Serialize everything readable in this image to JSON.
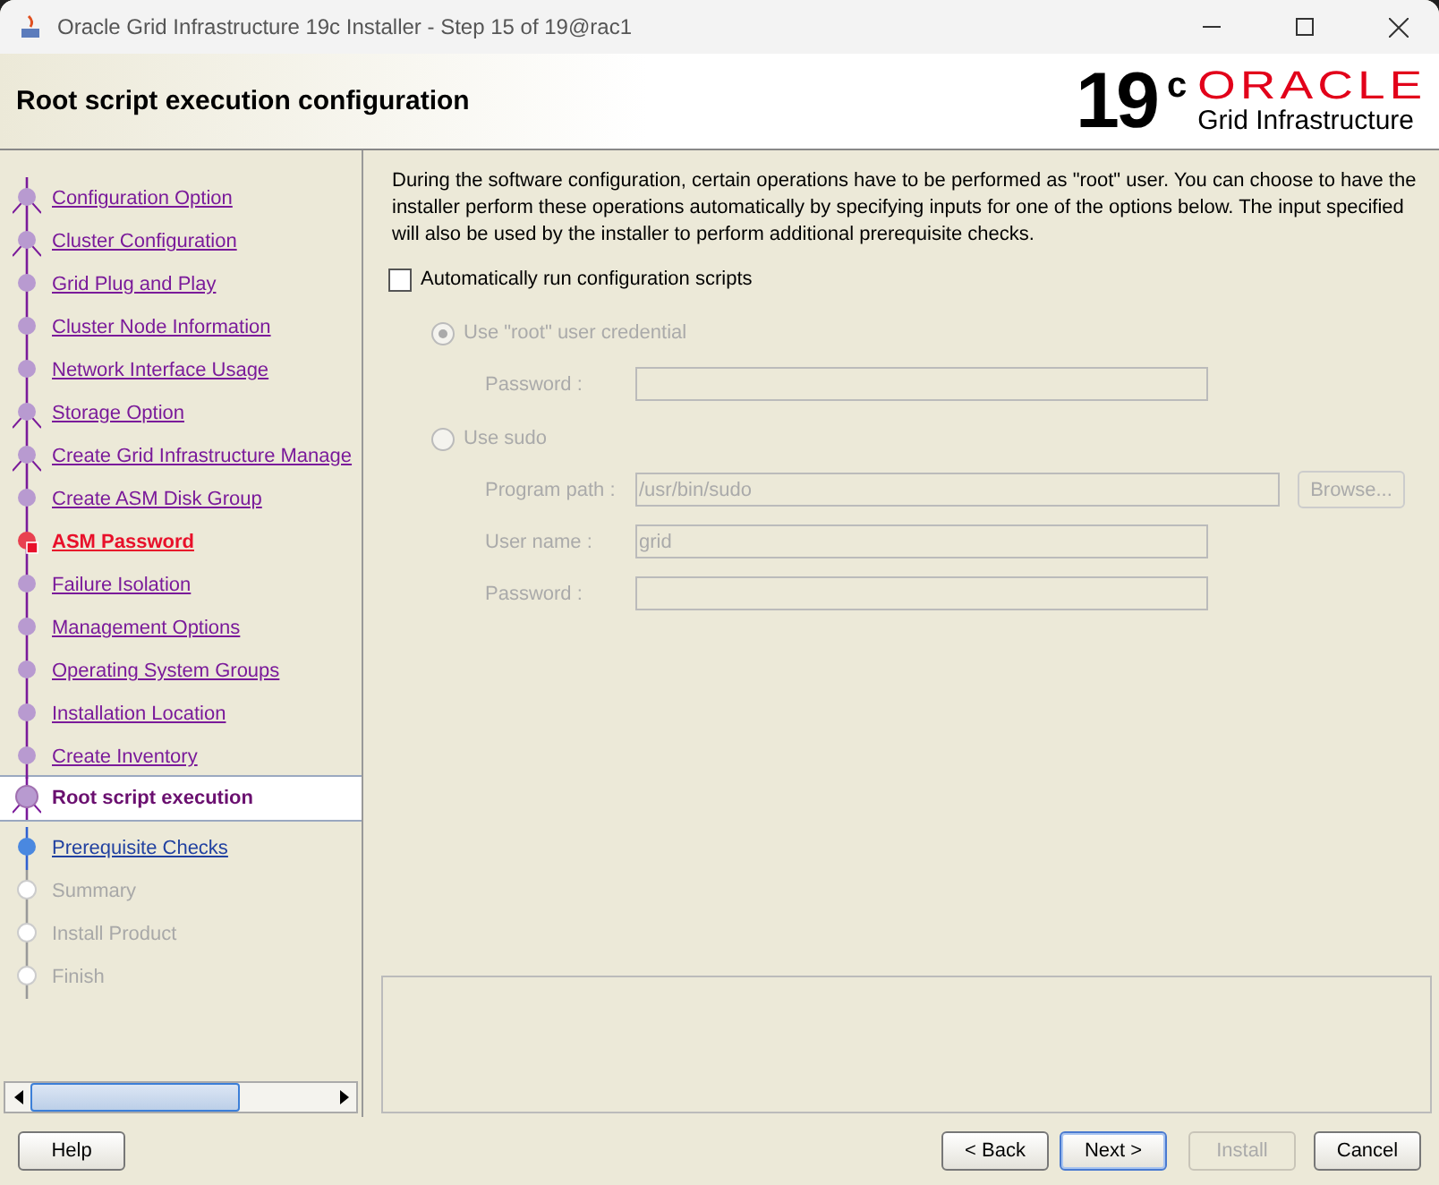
{
  "window": {
    "title": "Oracle Grid Infrastructure 19c Installer - Step 15 of 19@rac1"
  },
  "header": {
    "title": "Root script execution configuration",
    "logo_version": "19",
    "logo_suffix": "c",
    "logo_brand": "ORACLE",
    "logo_product": "Grid Infrastructure"
  },
  "steps": [
    {
      "label": "Configuration Option",
      "kind": "done",
      "branch": true
    },
    {
      "label": "Cluster Configuration",
      "kind": "done",
      "branch": true
    },
    {
      "label": "Grid Plug and Play",
      "kind": "done",
      "branch": false
    },
    {
      "label": "Cluster Node Information",
      "kind": "done",
      "branch": false
    },
    {
      "label": "Network Interface Usage",
      "kind": "done",
      "branch": false
    },
    {
      "label": "Storage Option",
      "kind": "done",
      "branch": true
    },
    {
      "label": "Create Grid Infrastructure Manage",
      "kind": "done",
      "branch": true
    },
    {
      "label": "Create ASM Disk Group",
      "kind": "done",
      "branch": false
    },
    {
      "label": "ASM Password",
      "kind": "error",
      "branch": false
    },
    {
      "label": "Failure Isolation",
      "kind": "done",
      "branch": false
    },
    {
      "label": "Management Options",
      "kind": "done",
      "branch": false
    },
    {
      "label": "Operating System Groups",
      "kind": "done",
      "branch": false
    },
    {
      "label": "Installation Location",
      "kind": "done",
      "branch": false
    },
    {
      "label": "Create Inventory",
      "kind": "done",
      "branch": false
    },
    {
      "label": "Root script execution",
      "kind": "current",
      "branch": true
    },
    {
      "label": "Prerequisite Checks",
      "kind": "next",
      "branch": false
    },
    {
      "label": "Summary",
      "kind": "pending",
      "branch": false
    },
    {
      "label": "Install Product",
      "kind": "pending",
      "branch": false
    },
    {
      "label": "Finish",
      "kind": "pending",
      "branch": false
    }
  ],
  "description": "During the software configuration, certain operations have to be performed as \"root\" user. You can choose to have the installer perform these operations automatically by specifying inputs for one of the options below. The input specified will also be used by the installer to perform additional prerequisite checks.",
  "auto_run": {
    "label": "Automatically run configuration scripts",
    "checked": false
  },
  "options": [
    {
      "label": "Use \"root\" user credential",
      "selected": true,
      "fields": [
        {
          "label": "Password :"
        }
      ]
    },
    {
      "label": "Use sudo",
      "selected": false,
      "fields": [
        {
          "label": "Program path :",
          "value": "/usr/bin/sudo",
          "browse": "Browse..."
        },
        {
          "label": "User name :",
          "value": "grid"
        },
        {
          "label": "Password :"
        }
      ]
    }
  ],
  "buttons": {
    "help": "Help",
    "back": "< Back",
    "next": "Next >",
    "install": "Install",
    "cancel": "Cancel"
  }
}
